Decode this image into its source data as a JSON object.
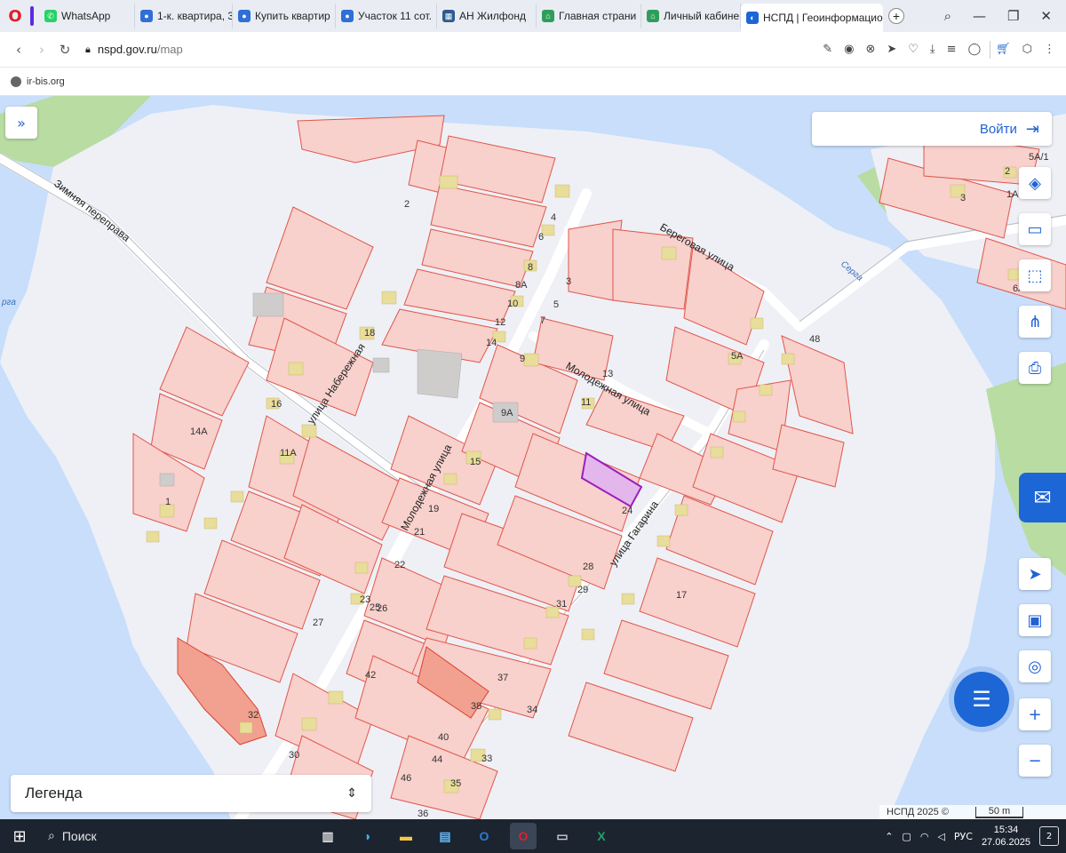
{
  "browser": {
    "tabs": [
      {
        "label": "WhatsApp",
        "color": "#25d366"
      },
      {
        "label": "1-к. квартира, 3(",
        "color": "#2f6fd6"
      },
      {
        "label": "Купить квартир",
        "color": "#2f6fd6"
      },
      {
        "label": "Участок 11 сот.",
        "color": "#2f6fd6"
      },
      {
        "label": "АН Жилфонд",
        "color": "#2d5b8f"
      },
      {
        "label": "Главная страни",
        "color": "#2e9e5a"
      },
      {
        "label": "Личный кабине",
        "color": "#2e9e5a"
      },
      {
        "label": "НСПД | Геоинформацио",
        "color": "#1d66d6"
      }
    ],
    "url_host": "nspd.gov.ru",
    "url_path": "/map",
    "bookmark": "ir-bis.org"
  },
  "map": {
    "login_label": "Войти",
    "legend_label": "Легенда",
    "attribution": "НСПД 2025 ©",
    "scale_label": "50 m",
    "streets": {
      "zimnyaya": "Зимняя переправа",
      "naberezhnaya": "улица Набережная",
      "molodezhnaya_long": "Молодежная улица",
      "molodezhnaya_short": "Молодежная улица",
      "beregovaya": "Береговая улица",
      "gagarina": "улица Гагарина"
    },
    "water_labels": [
      "Серга",
      "рга"
    ],
    "parcel_numbers": [
      "2",
      "4",
      "6",
      "8",
      "8А",
      "10",
      "12",
      "14",
      "14А",
      "16",
      "18",
      "1",
      "3",
      "5",
      "7",
      "9",
      "9А",
      "11",
      "11А",
      "13",
      "15",
      "17",
      "19",
      "21",
      "22",
      "23",
      "24",
      "25",
      "26",
      "27",
      "28",
      "29",
      "30",
      "31",
      "32",
      "33",
      "34",
      "35",
      "36",
      "37",
      "38",
      "40",
      "42",
      "44",
      "46",
      "48",
      "1А",
      "2",
      "5А",
      "6А",
      "3",
      "5А/1"
    ],
    "accent_color": "#1d66d6",
    "parcel_fill": "#f8d0cc",
    "parcel_stroke": "#e0564a",
    "selected_parcel_color": "#9b1fbf"
  },
  "taskbar": {
    "search_label": "Поиск",
    "language": "РУС",
    "time": "15:34",
    "date": "27.06.2025",
    "notification_count": "2"
  }
}
